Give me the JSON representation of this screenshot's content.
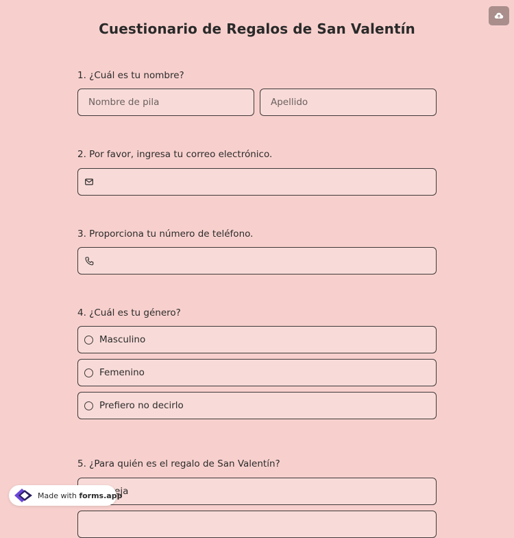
{
  "form": {
    "title": "Cuestionario de Regalos de San Valentín",
    "save_icon": "cloud-upload-icon",
    "q1": {
      "label": "1. ¿Cuál es tu nombre?",
      "first_name_placeholder": "Nombre de pila",
      "last_name_placeholder": "Apellido"
    },
    "q2": {
      "label": "2. Por favor, ingresa tu correo electrónico.",
      "icon": "mail-icon"
    },
    "q3": {
      "label": "3. Proporciona tu número de teléfono.",
      "icon": "phone-icon"
    },
    "q4": {
      "label": "4. ¿Cuál es tu género?",
      "options": [
        "Masculino",
        "Femenino",
        "Prefiero no decirlo"
      ]
    },
    "q5": {
      "label": "5. ¿Para quién es el regalo de San Valentín?",
      "options": [
        "Pareja"
      ]
    }
  },
  "badge": {
    "made_with": "Made with",
    "brand": "forms.app"
  },
  "colors": {
    "background": "#f7d0cd",
    "field": "#f8dbd8",
    "border": "#3e3838",
    "text": "#2b2b2b"
  }
}
